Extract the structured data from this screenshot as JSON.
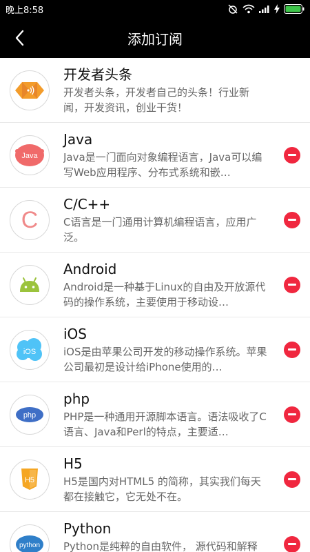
{
  "status": {
    "time": "晚上8:58"
  },
  "header": {
    "title": "添加订阅"
  },
  "items": [
    {
      "title": "开发者头条",
      "desc": "开发者头条，开发者自己的头条！行业新闻，开发资讯，创业干货！",
      "icon": "devtoutiao-logo",
      "removable": false
    },
    {
      "title": "Java",
      "desc": "Java是一门面向对象编程语言，Java可以编写Web应用程序、分布式系统和嵌…",
      "icon": "java-logo",
      "removable": true
    },
    {
      "title": "C/C++",
      "desc": "C语言是一门通用计算机编程语言，应用广泛。",
      "icon": "c-logo",
      "removable": true
    },
    {
      "title": "Android",
      "desc": "Android是一种基于Linux的自由及开放源代码的操作系统，主要使用于移动设…",
      "icon": "android-logo",
      "removable": true
    },
    {
      "title": "iOS",
      "desc": "iOS是由苹果公司开发的移动操作系统。苹果公司最初是设计给iPhone使用的…",
      "icon": "ios-logo",
      "removable": true
    },
    {
      "title": "php",
      "desc": "PHP是一种通用开源脚本语言。语法吸收了C语言、Java和Perl的特点，主要适…",
      "icon": "php-logo",
      "removable": true
    },
    {
      "title": "H5",
      "desc": "H5是国内对HTML5 的简称，其实我们每天都在接触它，它无处不在。",
      "icon": "h5-logo",
      "removable": true
    },
    {
      "title": "Python",
      "desc": "Python是纯粹的自由软件， 源代码和解释器CPython遵循GPL协议。",
      "icon": "python-logo",
      "removable": true
    }
  ],
  "logos": {
    "java_text": "Java",
    "c_text": "C",
    "ios_text": "iOS",
    "php_text": "php",
    "h5_text": "H5",
    "python_text": "python"
  },
  "colors": {
    "remove": "#f0273f",
    "devtoutiao": "#f39c2b",
    "java": "#f06a6a",
    "c": "#f08a8a",
    "android": "#9bc33c",
    "ios": "#4fc3f7",
    "php": "#3f6fc6",
    "h5": "#f5a623",
    "python": "#2f7fc9"
  }
}
